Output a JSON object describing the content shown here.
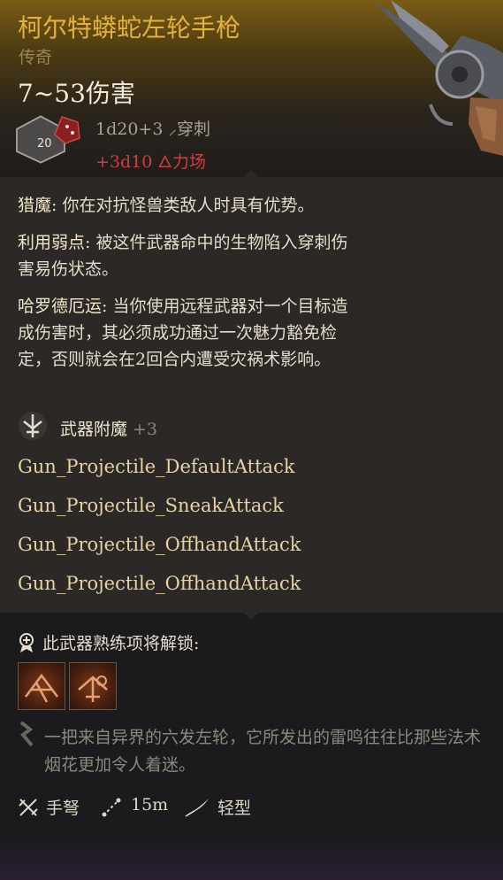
{
  "item": {
    "name": "柯尔特蟒蛇左轮手枪",
    "rarity": "传奇",
    "damage": "7~53伤害",
    "damage_line1_dice": "1d20+3",
    "damage_line1_type": "穿刺",
    "damage_line2_dice": "+3d10",
    "damage_line2_type": "力场"
  },
  "passives": [
    {
      "name": "猎魔",
      "text": ": 你在对抗怪兽类敌人时具有优势。"
    },
    {
      "name": "利用弱点",
      "text": ": 被这件武器命中的生物陷入穿刺伤害易伤状态。"
    },
    {
      "name": "哈罗德厄运",
      "text": ": 当你使用远程武器对一个目标造成伤害时，其必须成功通过一次魅力豁免检定，否则就会在2回合内遭受灾祸术影响。"
    }
  ],
  "enchantment": {
    "label": "武器附魔",
    "value": "+3"
  },
  "attacks": [
    "Gun_Projectile_DefaultAttack",
    "Gun_Projectile_SneakAttack",
    "Gun_Projectile_OffhandAttack",
    "Gun_Projectile_OffhandAttack"
  ],
  "proficiency": {
    "label": "此武器熟练项将解锁:"
  },
  "flavor": "一把来自异界的六发左轮，它所发出的雷鸣往往比那些法术烟花更加令人着迷。",
  "stats": {
    "type": "手弩",
    "range": "15m",
    "weight": "轻型"
  },
  "colors": {
    "title": "#e2b23c",
    "force": "#d23d3d",
    "attack": "#e7d2a2"
  }
}
